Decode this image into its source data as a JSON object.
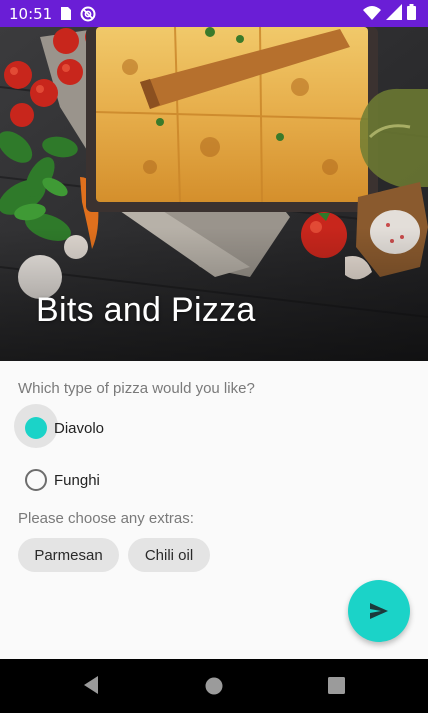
{
  "status_bar": {
    "time": "10:51",
    "icons_left": [
      "sim-card-icon",
      "dnd-icon"
    ],
    "icons_right": [
      "wifi-icon",
      "signal-icon",
      "battery-icon"
    ],
    "background": "#6a1ed6"
  },
  "hero": {
    "title": "Bits and Pizza"
  },
  "form": {
    "question": "Which type of pizza would you like?",
    "options": [
      {
        "label": "Diavolo",
        "selected": true
      },
      {
        "label": "Funghi",
        "selected": false
      }
    ],
    "extras_label": "Please choose any extras:",
    "extras": [
      "Parmesan",
      "Chili oil"
    ]
  },
  "fab": {
    "icon": "send-icon",
    "color": "#1bd3c8"
  },
  "nav_bar": {
    "icons": [
      "back-icon",
      "home-icon",
      "recents-icon"
    ]
  }
}
